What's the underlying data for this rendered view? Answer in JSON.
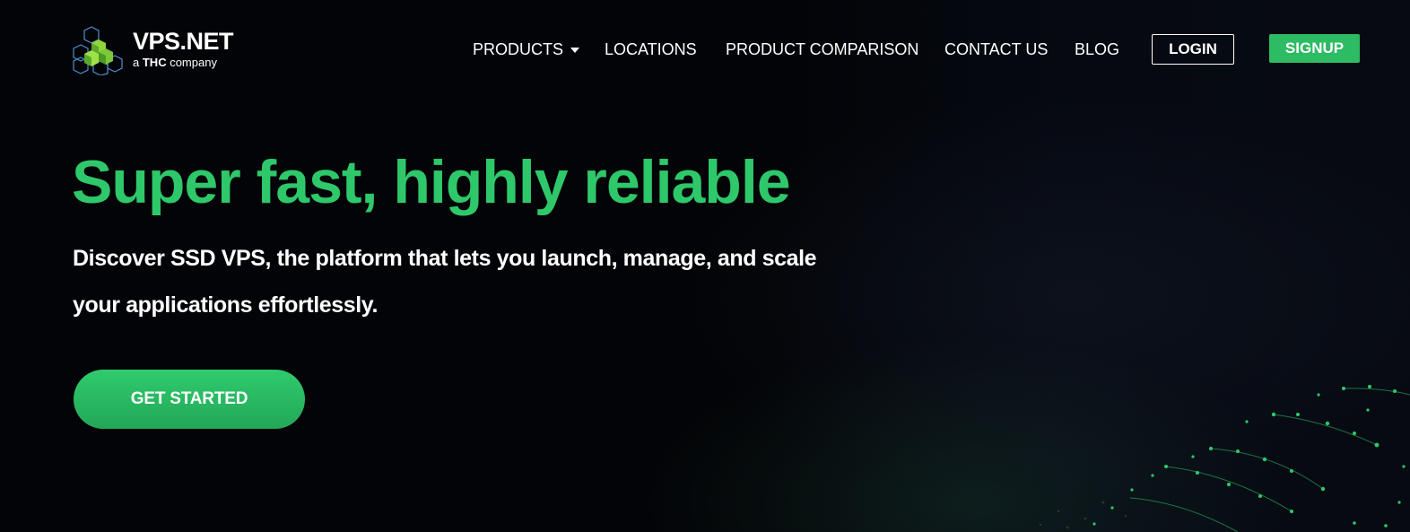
{
  "brand": {
    "name": "VPS.NET",
    "tagline_prefix": "a",
    "tagline_bold": "THC",
    "tagline_suffix": "company"
  },
  "nav": {
    "items": [
      {
        "label": "PRODUCTS",
        "has_dropdown": true
      },
      {
        "label": "LOCATIONS"
      },
      {
        "label": "PRODUCT COMPARISON"
      },
      {
        "label": "CONTACT US"
      },
      {
        "label": "BLOG"
      }
    ],
    "login_label": "LOGIN",
    "signup_label": "SIGNUP"
  },
  "hero": {
    "headline": "Super fast, highly reliable",
    "subtitle": "Discover SSD VPS, the platform that lets you launch, manage, and scale your applications effortlessly.",
    "cta_label": "GET STARTED"
  },
  "colors": {
    "accent_green": "#2ec86b",
    "background": "#030407",
    "text": "#ffffff"
  },
  "icons": {
    "logo": "cube-cluster-logo-icon",
    "products_caret": "caret-down-icon"
  }
}
